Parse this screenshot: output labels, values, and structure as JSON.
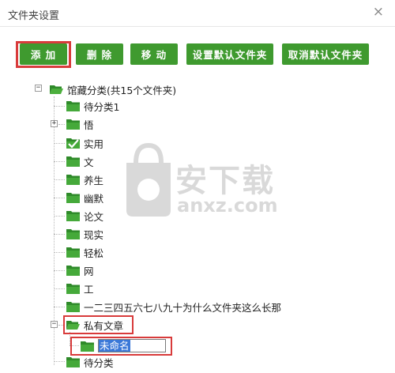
{
  "window": {
    "title": "文件夹设置",
    "close_glyph": "×"
  },
  "toolbar": {
    "add": "添 加",
    "delete": "删 除",
    "move": "移 动",
    "set_default": "设置默认文件夹",
    "cancel_default": "取消默认文件夹"
  },
  "tree": {
    "root": "馆藏分类(共15个文件夹)",
    "items": [
      "待分类1",
      "悟",
      "实用",
      "文",
      "养生",
      "幽默",
      "论文",
      "现实",
      "轻松",
      "网",
      "工",
      "一二三四五六七八九十为什么文件夹这么长那",
      "私有文章",
      "未命名",
      "待分类"
    ]
  },
  "watermark": {
    "brand": "安下载",
    "domain": "anxz.com"
  },
  "colors": {
    "button_green": "#3f9a2f",
    "highlight_red": "#d83b3b",
    "folder_green": "#2f8a2a",
    "selection_blue": "#3a78d8"
  }
}
